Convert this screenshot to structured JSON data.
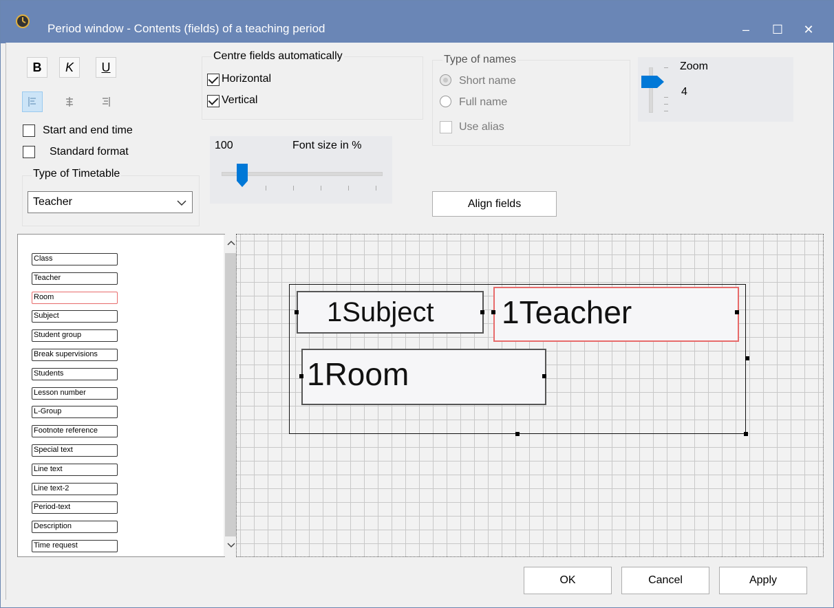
{
  "window": {
    "title": "Period window - Contents (fields) of a teaching period",
    "minimize": "–",
    "maximize": "☐",
    "close": "✕"
  },
  "format_buttons": {
    "bold": "B",
    "italic": "K",
    "underline": "U"
  },
  "alignment": {
    "active": "left"
  },
  "options": {
    "start_end_time": {
      "label": "Start and end time",
      "checked": false
    },
    "standard_format": {
      "label": "Standard format",
      "checked": false
    }
  },
  "timetable_type": {
    "label": "Type of Timetable",
    "value": "Teacher"
  },
  "centre_fields": {
    "label": "Centre fields automatically",
    "horizontal": {
      "label": "Horizontal",
      "checked": true
    },
    "vertical": {
      "label": "Vertical",
      "checked": true
    }
  },
  "font_size": {
    "value": "100",
    "label": "Font size in %"
  },
  "type_of_names": {
    "label": "Type of names",
    "short_name": "Short name",
    "full_name": "Full name",
    "use_alias": "Use alias",
    "selected": "short_name"
  },
  "zoom": {
    "label": "Zoom",
    "value": "4"
  },
  "align_fields_button": "Align fields",
  "field_list": [
    "Class",
    "Teacher",
    "Room",
    "Subject",
    "Student group",
    "Break supervisions",
    "Students",
    "Lesson number",
    "L-Group",
    "Footnote reference",
    "Special text",
    "Line text",
    "Line text-2",
    "Period-text",
    "Description",
    "Time request"
  ],
  "field_list_selected": "Room",
  "canvas_fields": {
    "subject": "1Subject",
    "teacher": "1Teacher",
    "room": "1Room"
  },
  "buttons": {
    "ok": "OK",
    "cancel": "Cancel",
    "apply": "Apply"
  },
  "colors": {
    "titlebar": "#6a86b6",
    "accent": "#0078d7",
    "selection": "#e76a6a"
  }
}
